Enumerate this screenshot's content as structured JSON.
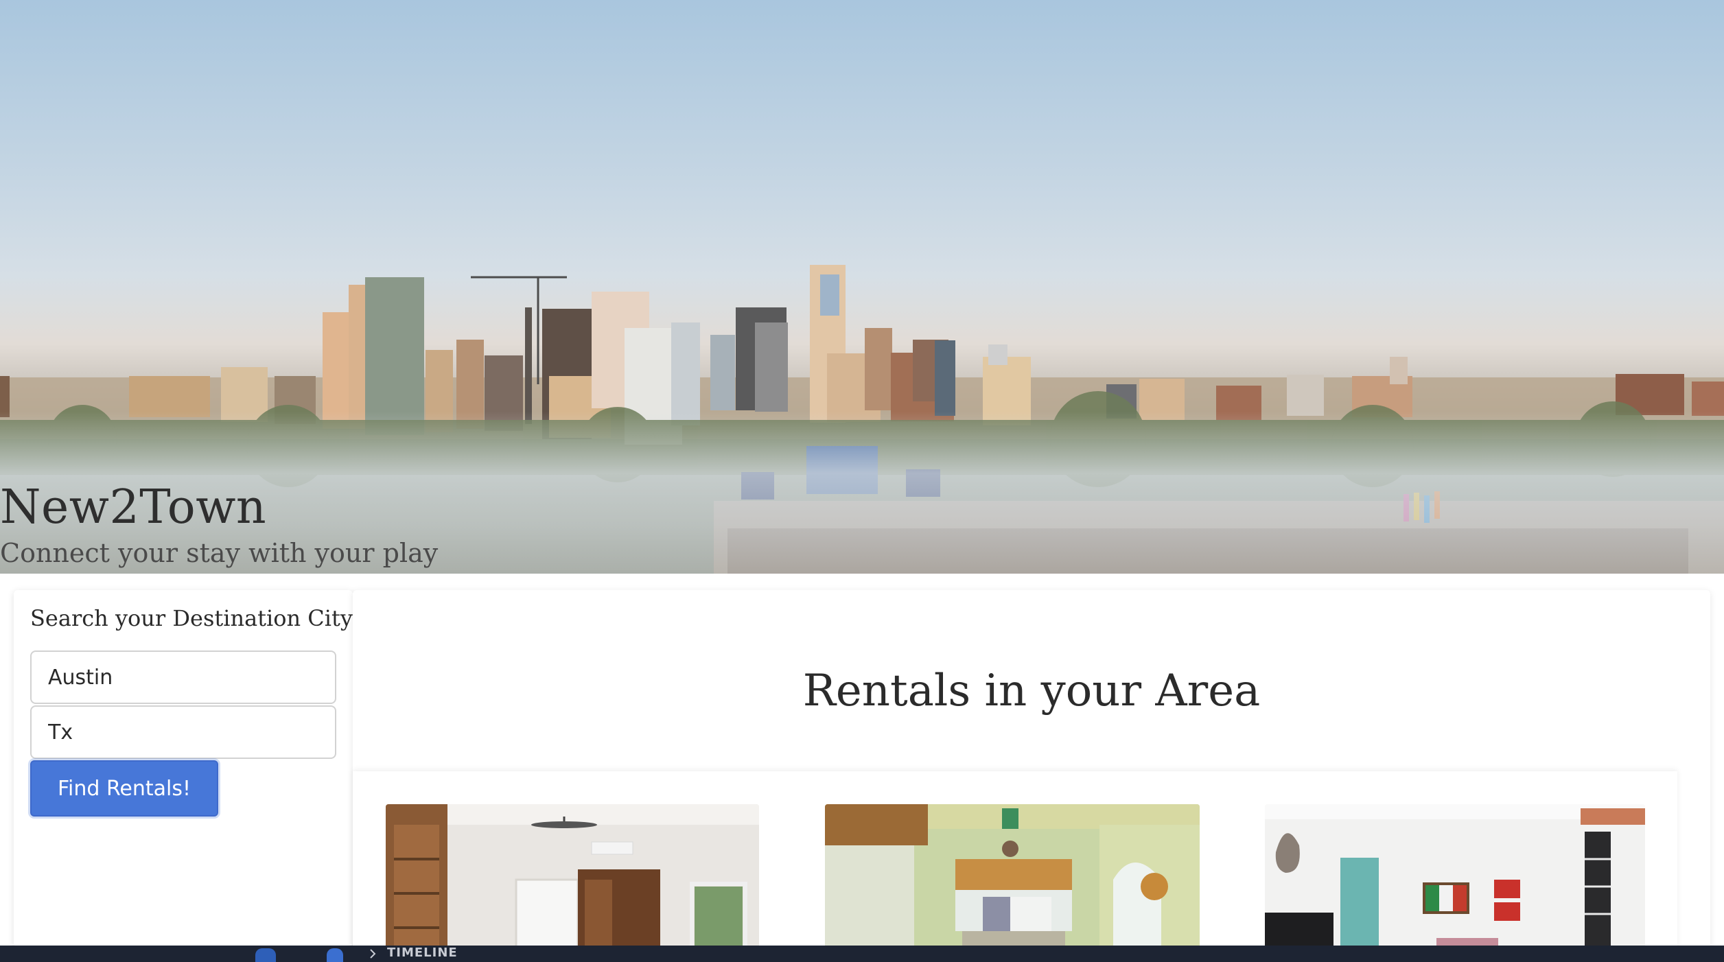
{
  "hero": {
    "title": "New2Town",
    "tagline": "Connect your stay with your play"
  },
  "search": {
    "heading": "Search your Destination City",
    "city_value": "Austin",
    "state_value": "Tx",
    "button_label": "Find Rentals!"
  },
  "rentals": {
    "heading": "Rentals in your Area",
    "cards": [
      {
        "image": "rental-photo-bedroom"
      },
      {
        "image": "rental-photo-camper-interior"
      },
      {
        "image": "rental-photo-living-room"
      }
    ]
  },
  "taskbar": {
    "timeline_label": "TIMELINE"
  },
  "colors": {
    "primary_button": "#4777d8",
    "sky_top": "#a9c6de",
    "text_dark": "#2b2b2b"
  }
}
